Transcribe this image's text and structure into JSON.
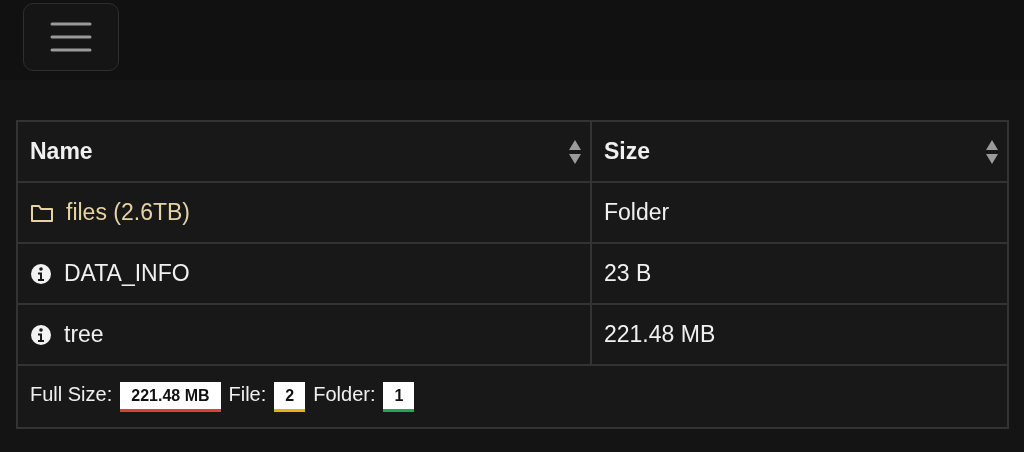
{
  "table": {
    "columns": [
      {
        "label": "Name"
      },
      {
        "label": "Size"
      }
    ],
    "rows": [
      {
        "kind": "folder",
        "name": "files (2.6TB)",
        "size": "Folder"
      },
      {
        "kind": "file",
        "name": "DATA_INFO",
        "size": "23 B"
      },
      {
        "kind": "file",
        "name": "tree",
        "size": "221.48 MB"
      }
    ],
    "summary": [
      {
        "label": "Full Size:",
        "value": "221.48 MB",
        "color": "#d9432f"
      },
      {
        "label": "File:",
        "value": "2",
        "color": "#e8b10e"
      },
      {
        "label": "Folder:",
        "value": "1",
        "color": "#1fa855"
      }
    ]
  }
}
